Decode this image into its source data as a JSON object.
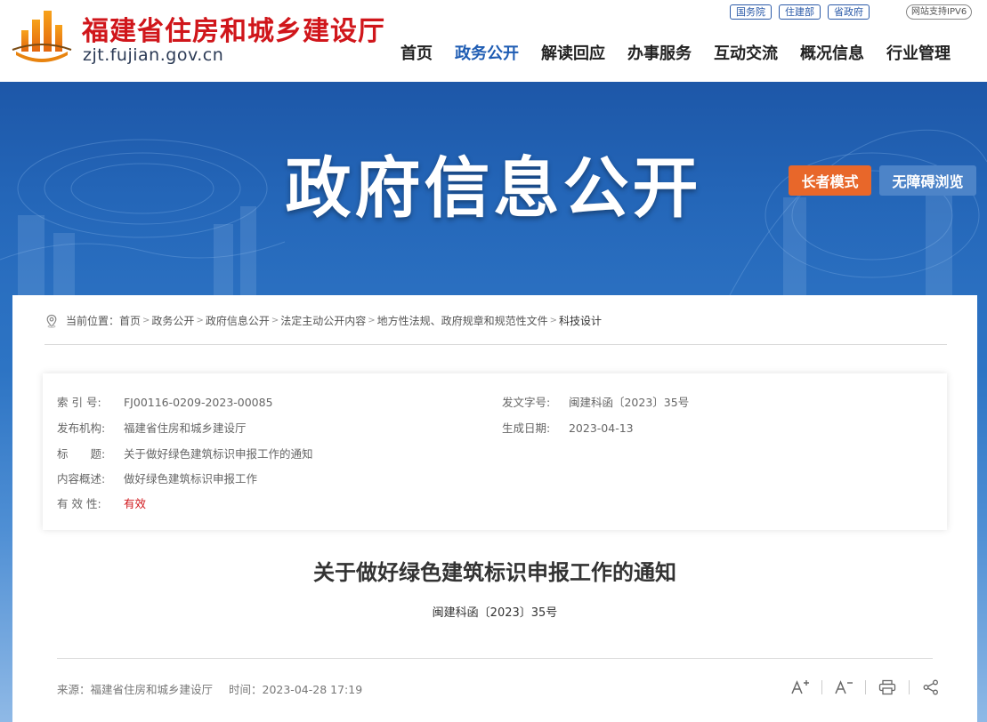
{
  "header": {
    "site_name": "福建省住房和城乡建设厅",
    "domain": "zjt.fujian.gov.cn",
    "top_links": [
      "国务院",
      "住建部",
      "省政府"
    ],
    "ipv6_badge": "网站支持IPV6",
    "nav": [
      {
        "label": "首页",
        "active": false
      },
      {
        "label": "政务公开",
        "active": true
      },
      {
        "label": "解读回应",
        "active": false
      },
      {
        "label": "办事服务",
        "active": false
      },
      {
        "label": "互动交流",
        "active": false
      },
      {
        "label": "概况信息",
        "active": false
      },
      {
        "label": "行业管理",
        "active": false
      }
    ]
  },
  "banner": {
    "title": "政府信息公开",
    "elder_mode": "长者模式",
    "accessible": "无障碍浏览"
  },
  "breadcrumb": {
    "prefix": "当前位置：",
    "items": [
      "首页",
      "政务公开",
      "政府信息公开",
      "法定主动公开内容",
      "地方性法规、政府规章和规范性文件",
      "科技设计"
    ]
  },
  "meta": {
    "index_label": "索 引 号:",
    "index_value": "FJ00116-0209-2023-00085",
    "doc_no_label": "发文字号:",
    "doc_no_value": "闽建科函〔2023〕35号",
    "org_label": "发布机构:",
    "org_value": "福建省住房和城乡建设厅",
    "date_label": "生成日期:",
    "date_value": "2023-04-13",
    "title_label": "标　　题:",
    "title_value": "关于做好绿色建筑标识申报工作的通知",
    "summary_label": "内容概述:",
    "summary_value": "做好绿色建筑标识申报工作",
    "validity_label": "有 效 性:",
    "validity_value": "有效"
  },
  "document": {
    "title": "关于做好绿色建筑标识申报工作的通知",
    "number": "闽建科函〔2023〕35号",
    "source": "来源：福建省住房和城乡建设厅",
    "time": "时间：2023-04-28 17:19"
  },
  "colors": {
    "brand_red": "#d0161b",
    "nav_active": "#1e5cb3",
    "banner_blue": "#1d57a8",
    "elder_orange": "#e8672a",
    "access_blue": "#4d84c8"
  },
  "icons": [
    "location-pin-icon",
    "font-increase-icon",
    "font-decrease-icon",
    "print-icon",
    "share-icon"
  ]
}
